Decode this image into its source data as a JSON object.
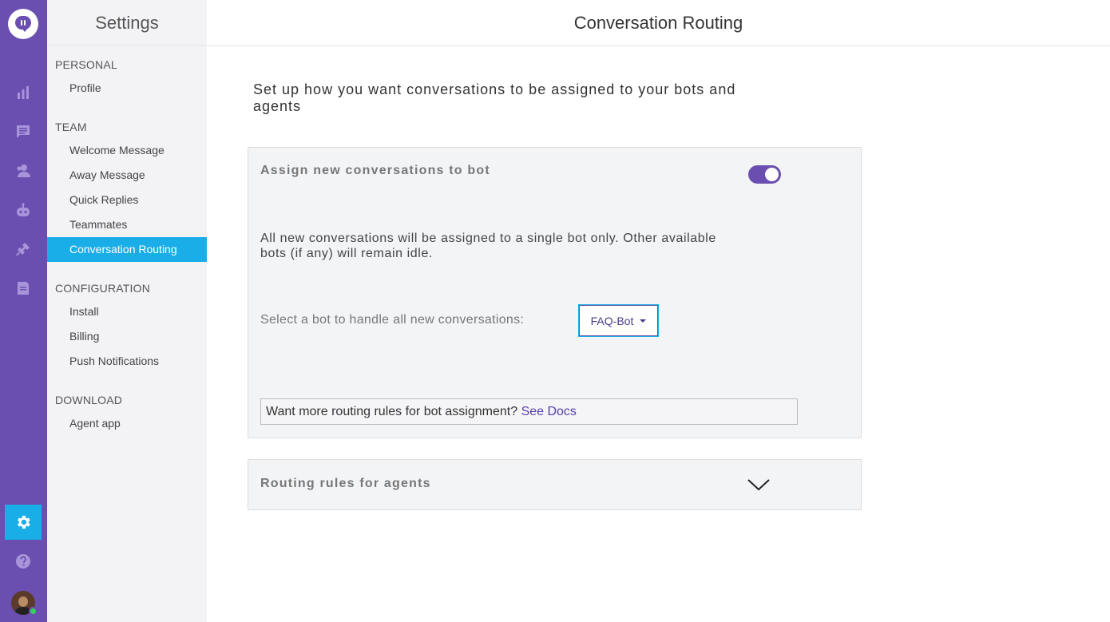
{
  "rail": {
    "icons": [
      "logo-icon",
      "analytics-icon",
      "conversations-icon",
      "users-icon",
      "bot-icon",
      "integrations-icon",
      "docs-icon",
      "settings-icon",
      "help-icon"
    ],
    "accent": "#6a4fb0",
    "active_color": "#1aaee8",
    "online_status_color": "#35d05a"
  },
  "sidebar": {
    "title": "Settings",
    "sections": [
      {
        "heading": "PERSONAL",
        "items": [
          "Profile"
        ]
      },
      {
        "heading": "TEAM",
        "items": [
          "Welcome Message",
          "Away Message",
          "Quick Replies",
          "Teammates",
          "Conversation Routing"
        ]
      },
      {
        "heading": "CONFIGURATION",
        "items": [
          "Install",
          "Billing",
          "Push Notifications"
        ]
      },
      {
        "heading": "DOWNLOAD",
        "items": [
          "Agent app"
        ]
      }
    ],
    "active_item": "Conversation Routing"
  },
  "header": {
    "title": "Conversation Routing"
  },
  "main": {
    "intro": "Set up how you want conversations to be assigned to your bots and agents",
    "bot_card": {
      "title": "Assign new conversations to bot",
      "toggle_on": true,
      "description": "All new conversations will be assigned to a single bot only. Other available bots (if any) will remain idle.",
      "select_label": "Select a bot to handle all new conversations:",
      "selected_bot": "FAQ-Bot",
      "docs_text": "Want more routing rules for bot assignment?",
      "docs_link": "See Docs"
    },
    "agent_card": {
      "title": "Routing rules for agents",
      "expanded": false
    }
  }
}
